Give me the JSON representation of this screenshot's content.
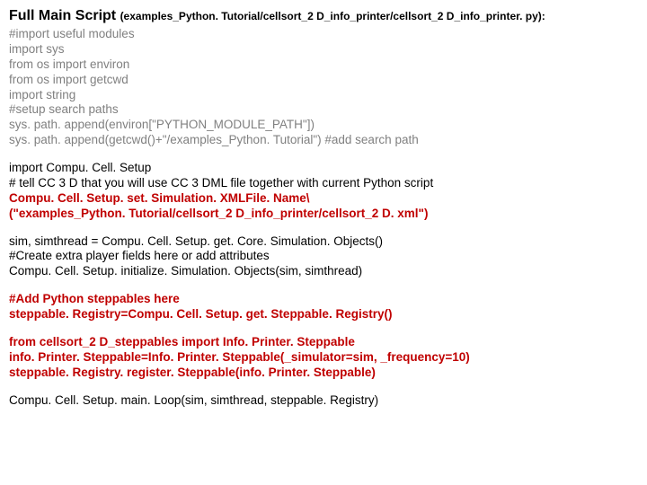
{
  "header": {
    "title": "Full Main Script ",
    "path": "(examples_Python. Tutorial/cellsort_2 D_info_printer/cellsort_2 D_info_printer. py):"
  },
  "block1": {
    "l1": "#import useful modules",
    "l2": "import sys",
    "l3": "from os import environ",
    "l4": "from os import getcwd",
    "l5": "import string",
    "l6": "#setup search paths",
    "l7": "sys. path. append(environ[\"PYTHON_MODULE_PATH\"])",
    "l8a": "sys. path. append(getcwd()+\"/examples_Python. Tutorial\") ",
    "l8b": "#add search path"
  },
  "block2": {
    "l1": "import Compu. Cell. Setup",
    "l2": "# tell CC 3 D that you will use CC 3 DML file together with current Python script",
    "l3": "Compu. Cell. Setup. set. Simulation. XMLFile. Name\\",
    "l4": "(\"examples_Python. Tutorial/cellsort_2 D_info_printer/cellsort_2 D. xml\")"
  },
  "block3": {
    "l1": "sim, simthread = Compu. Cell. Setup. get. Core. Simulation. Objects()",
    "l2": "#Create extra player fields here or add attributes",
    "l3": "Compu. Cell. Setup. initialize. Simulation. Objects(sim, simthread)"
  },
  "block4": {
    "l1": "#Add Python steppables here",
    "l2": "steppable. Registry=Compu. Cell. Setup. get. Steppable. Registry()"
  },
  "block5": {
    "l1": "from cellsort_2 D_steppables import Info. Printer. Steppable",
    "l2": "info. Printer. Steppable=Info. Printer. Steppable(_simulator=sim, _frequency=10)",
    "l3": "steppable. Registry. register. Steppable(info. Printer. Steppable)"
  },
  "block6": {
    "l1": "Compu. Cell. Setup. main. Loop(sim, simthread, steppable. Registry)"
  }
}
